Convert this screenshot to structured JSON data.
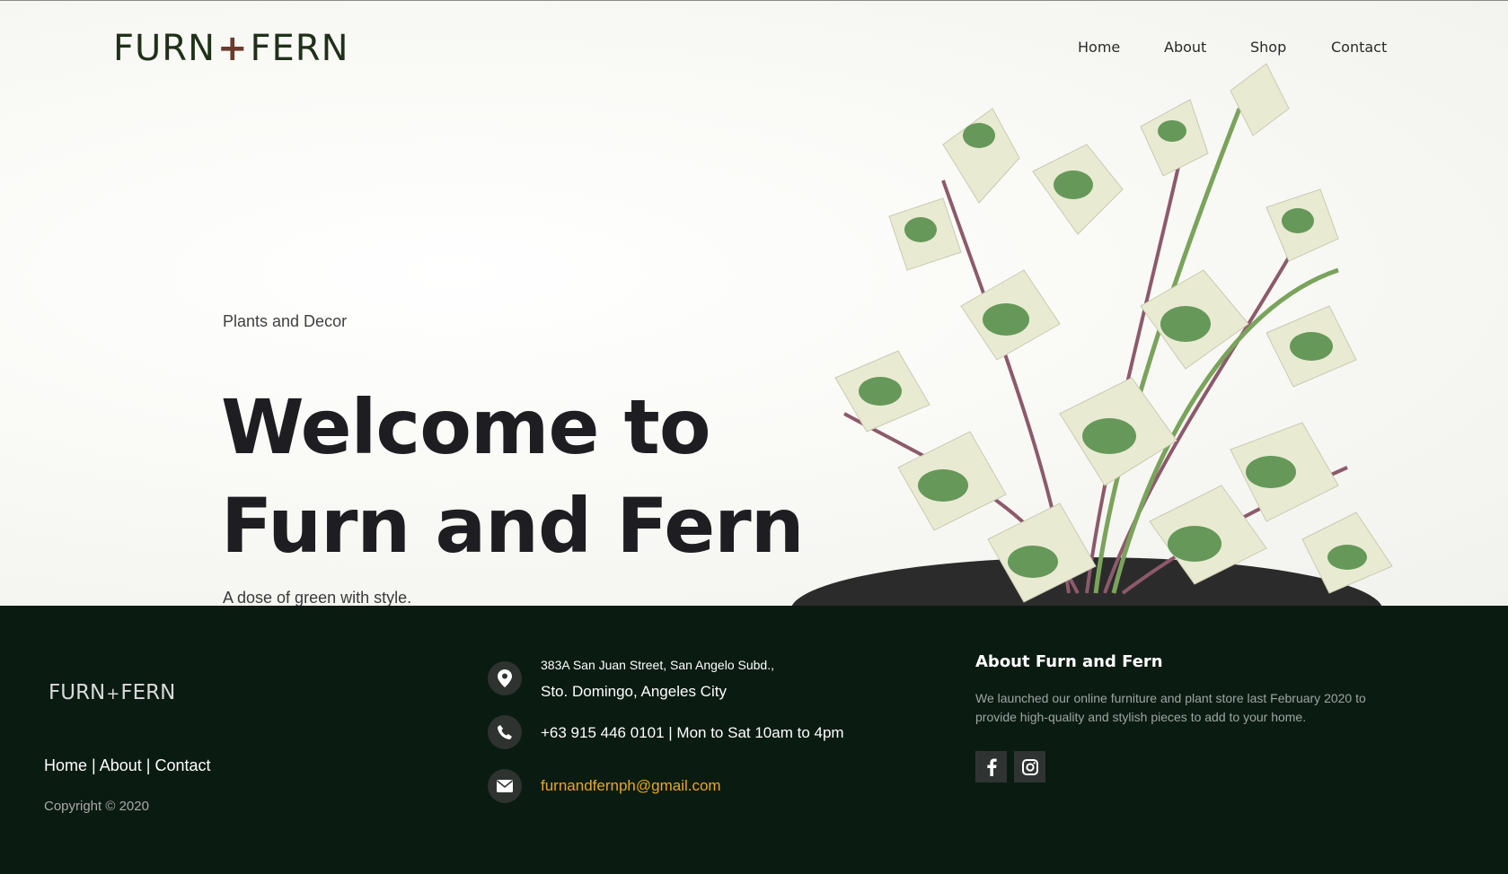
{
  "header": {
    "logo_left": "FURN",
    "logo_plus": "+",
    "logo_right": "FERN",
    "nav": [
      "Home",
      "About",
      "Shop",
      "Contact"
    ]
  },
  "hero": {
    "eyebrow": "Plants and Decor",
    "headline_line1": "Welcome to",
    "headline_line2": "Furn and Fern",
    "tagline": "A dose of green with style."
  },
  "footer": {
    "logo_left": "FURN",
    "logo_plus": "+",
    "logo_right": "FERN",
    "links": [
      "Home",
      "About",
      "Contact"
    ],
    "link_separator": "|",
    "copyright": "Copyright © 2020",
    "address_line1": "383A San Juan Street, San Angelo Subd.,",
    "address_line2": "Sto. Domingo, Angeles City",
    "phone": "+63 915 446 0101 | Mon to Sat 10am to 4pm",
    "email": "furnandfernph@gmail.com",
    "about_title": "About Furn and Fern",
    "about_text": "We launched our online furniture and plant store last February 2020 to provide high-quality and stylish pieces to add to your home.",
    "social": [
      "facebook-icon",
      "instagram-icon"
    ]
  },
  "colors": {
    "logo_green": "#1f3118",
    "logo_plus": "#6b3b2c",
    "footer_bg": "#0a1b12",
    "email_accent": "#e8a824",
    "headline": "#1e1e22"
  }
}
